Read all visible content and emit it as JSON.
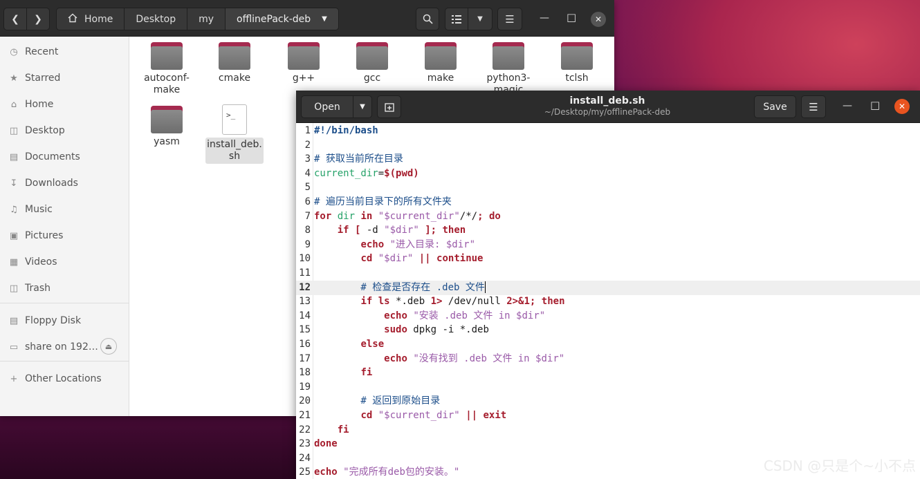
{
  "files": {
    "breadcrumbs": [
      "Home",
      "Desktop",
      "my",
      "offlinePack-deb"
    ],
    "sidebar": [
      {
        "label": "Recent",
        "icon": "clock-icon"
      },
      {
        "label": "Starred",
        "icon": "star-icon"
      },
      {
        "label": "Home",
        "icon": "home-icon"
      },
      {
        "label": "Desktop",
        "icon": "desktop-icon"
      },
      {
        "label": "Documents",
        "icon": "document-icon"
      },
      {
        "label": "Downloads",
        "icon": "download-icon"
      },
      {
        "label": "Music",
        "icon": "music-icon"
      },
      {
        "label": "Pictures",
        "icon": "picture-icon"
      },
      {
        "label": "Videos",
        "icon": "video-icon"
      },
      {
        "label": "Trash",
        "icon": "trash-icon"
      }
    ],
    "devices": [
      {
        "label": "Floppy Disk",
        "icon": "floppy-icon"
      },
      {
        "label": "share on 192…",
        "icon": "network-folder-icon"
      }
    ],
    "other_locations": "Other Locations",
    "items": [
      {
        "name": "autoconf-\nmake",
        "type": "folder"
      },
      {
        "name": "cmake",
        "type": "folder"
      },
      {
        "name": "g++",
        "type": "folder"
      },
      {
        "name": "gcc",
        "type": "folder"
      },
      {
        "name": "make",
        "type": "folder"
      },
      {
        "name": "python3-\nmagic",
        "type": "folder"
      },
      {
        "name": "tclsh",
        "type": "folder"
      },
      {
        "name": "yasm",
        "type": "folder"
      },
      {
        "name": "install_deb.\nsh",
        "type": "script",
        "selected": true
      }
    ]
  },
  "gedit": {
    "open_label": "Open",
    "save_label": "Save",
    "title": "install_deb.sh",
    "subtitle": "~/Desktop/my/offlinePack-deb",
    "current_line": 12,
    "lines": [
      "#!/bin/bash",
      "",
      "# 获取当前所在目录",
      "current_dir=$(pwd)",
      "",
      "# 遍历当前目录下的所有文件夹",
      "for dir in \"$current_dir\"/*/; do",
      "    if [ -d \"$dir\" ]; then",
      "        echo \"进入目录: $dir\"",
      "        cd \"$dir\" || continue",
      "",
      "        # 检查是否存在 .deb 文件",
      "        if ls *.deb 1> /dev/null 2>&1; then",
      "            echo \"安装 .deb 文件 in $dir\"",
      "            sudo dpkg -i *.deb",
      "        else",
      "            echo \"没有找到 .deb 文件 in $dir\"",
      "        fi",
      "",
      "        # 返回到原始目录",
      "        cd \"$current_dir\" || exit",
      "    fi",
      "done",
      "",
      "echo \"完成所有deb包的安装。\""
    ]
  },
  "watermark": "CSDN @只是个~小不点",
  "colors": {
    "keyword": "#a51d2d",
    "variable": "#26a269",
    "string": "#9a5aa8",
    "comment": "#1c4e8a",
    "ubuntu_orange": "#e95420"
  }
}
